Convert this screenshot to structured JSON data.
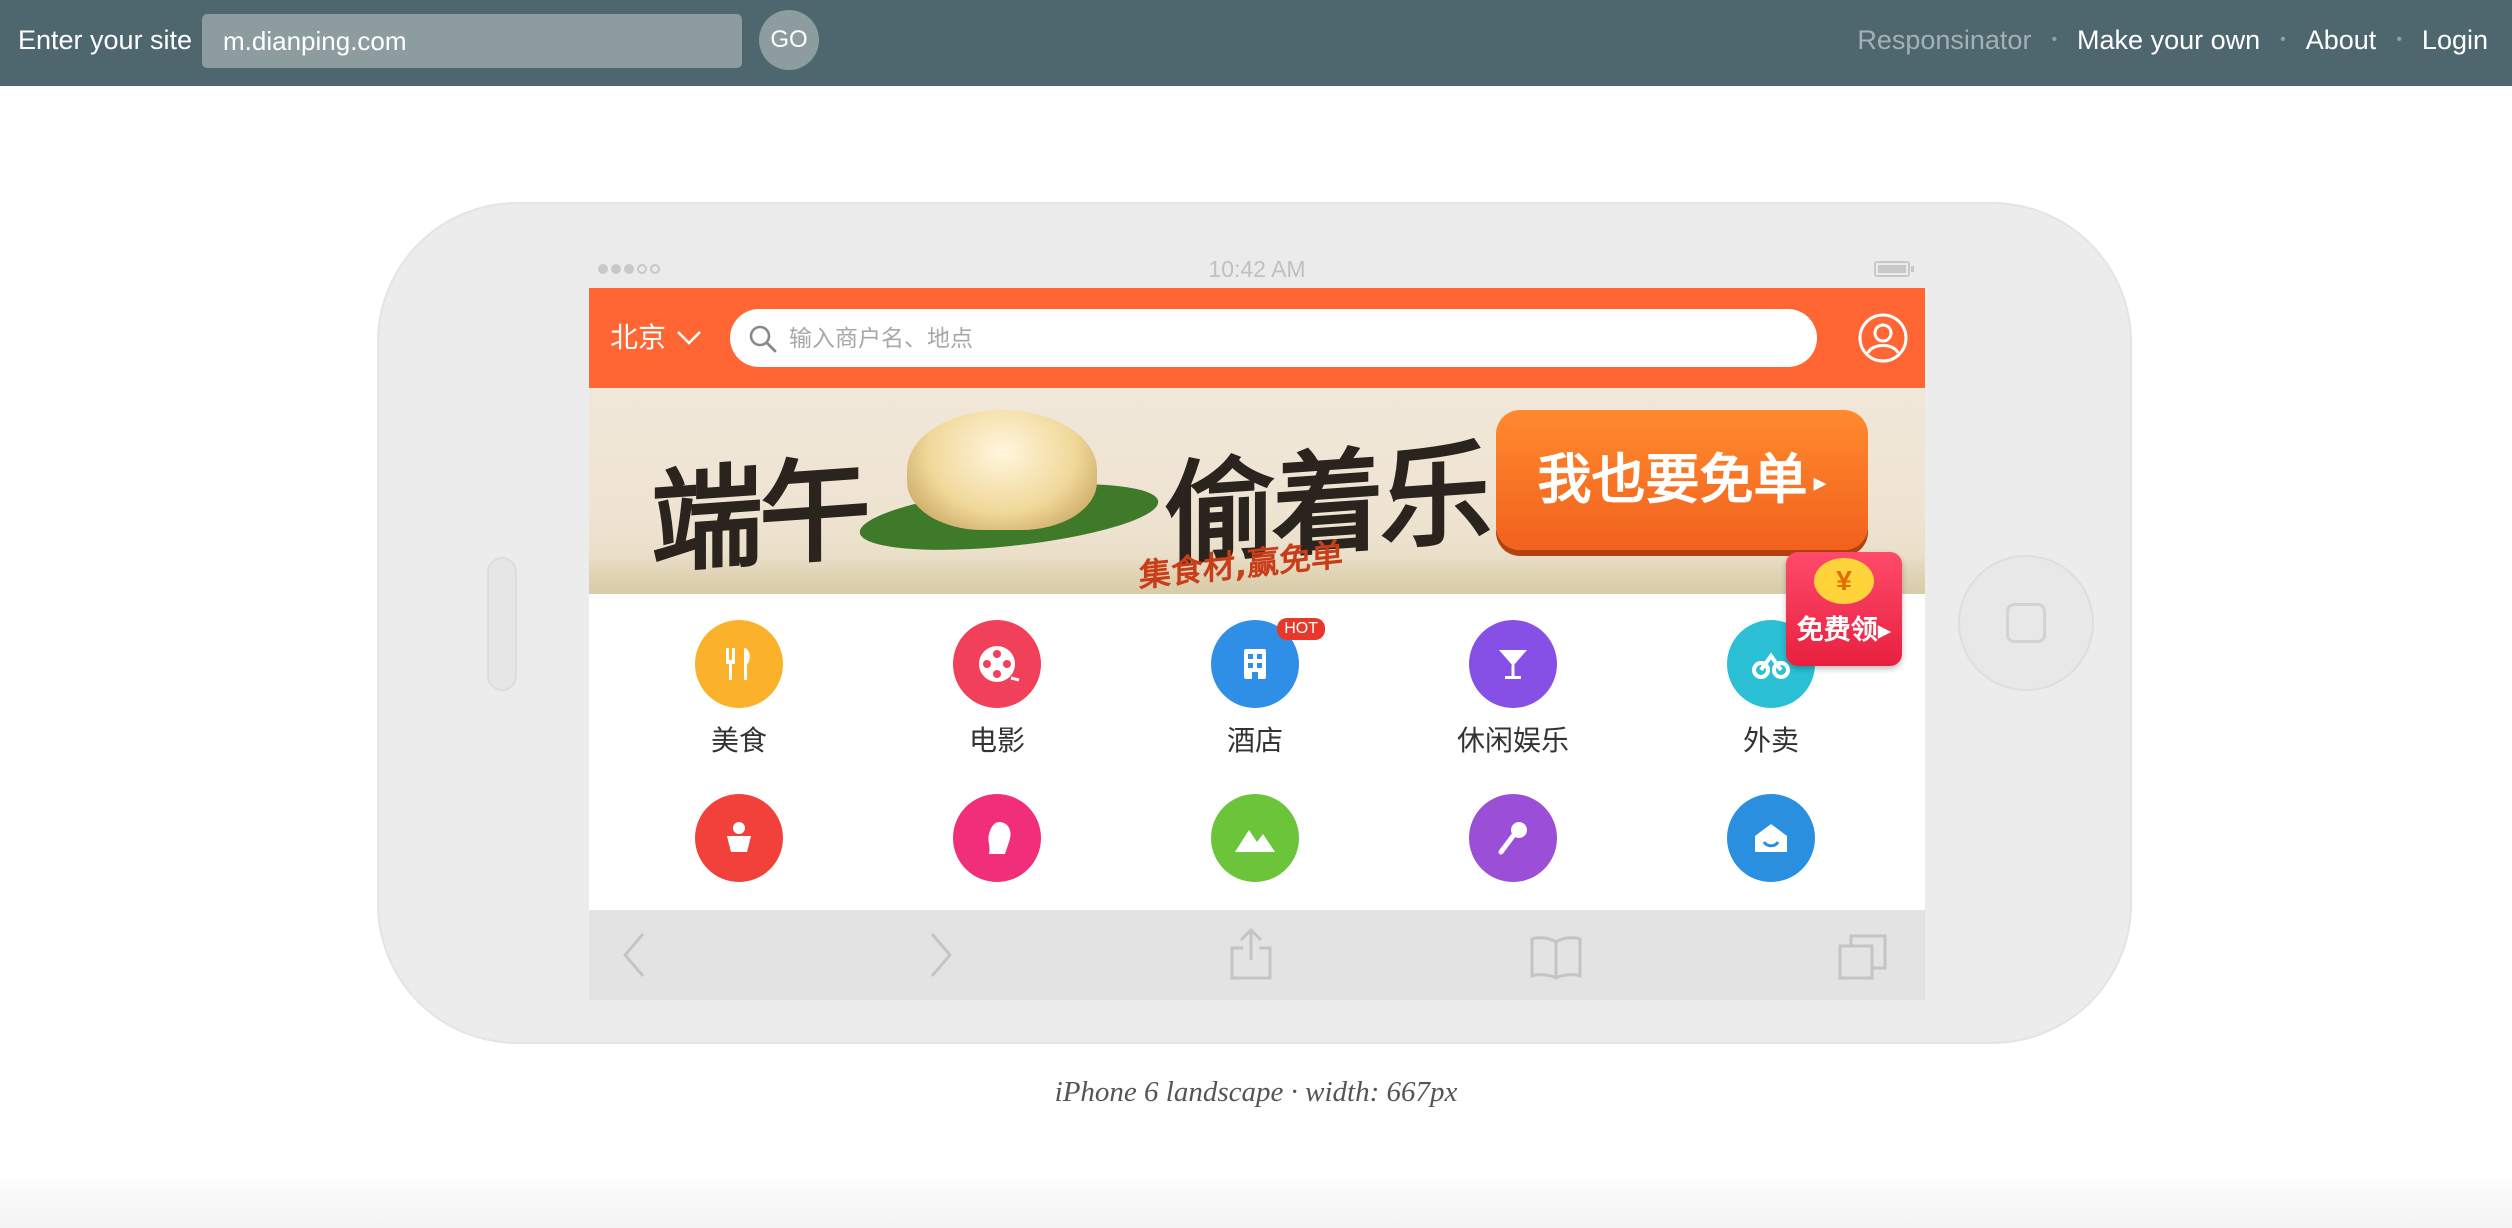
{
  "toolbar": {
    "label": "Enter your site",
    "url_value": "m.dianping.com",
    "go_label": "GO",
    "nav": [
      "Responsinator",
      "Make your own",
      "About",
      "Login"
    ]
  },
  "device": {
    "status_time": "10:42 AM",
    "caption": "iPhone 6 landscape · width: 667px"
  },
  "app": {
    "city": "北京",
    "search_placeholder": "输入商户名、地点",
    "banner": {
      "title_left": "端午",
      "title_right": "偷着乐",
      "subtitle": "集食材,赢免单",
      "button": "我也要免单"
    },
    "free_badge": {
      "symbol": "¥",
      "label": "免费领"
    },
    "categories": [
      {
        "label": "美食",
        "icon": "utensils-icon",
        "color": "#fbb12a"
      },
      {
        "label": "电影",
        "icon": "film-reel-icon",
        "color": "#f0405a"
      },
      {
        "label": "酒店",
        "icon": "hotel-building-icon",
        "color": "#2f8ee6",
        "badge": "HOT"
      },
      {
        "label": "休闲娱乐",
        "icon": "cocktail-icon",
        "color": "#8650e6"
      },
      {
        "label": "外卖",
        "icon": "scooter-icon",
        "color": "#2bc0d6"
      }
    ],
    "categories_row2": [
      {
        "icon": "cake-icon",
        "color": "#f2403a"
      },
      {
        "icon": "woman-profile-icon",
        "color": "#f02e7a"
      },
      {
        "icon": "mountain-icon",
        "color": "#6cc43a"
      },
      {
        "icon": "microphone-icon",
        "color": "#9b4fd6"
      },
      {
        "icon": "house-smile-icon",
        "color": "#2b8fe0"
      }
    ]
  },
  "colors": {
    "topbar": "#4e666e",
    "app_orange": "#ff6633"
  }
}
